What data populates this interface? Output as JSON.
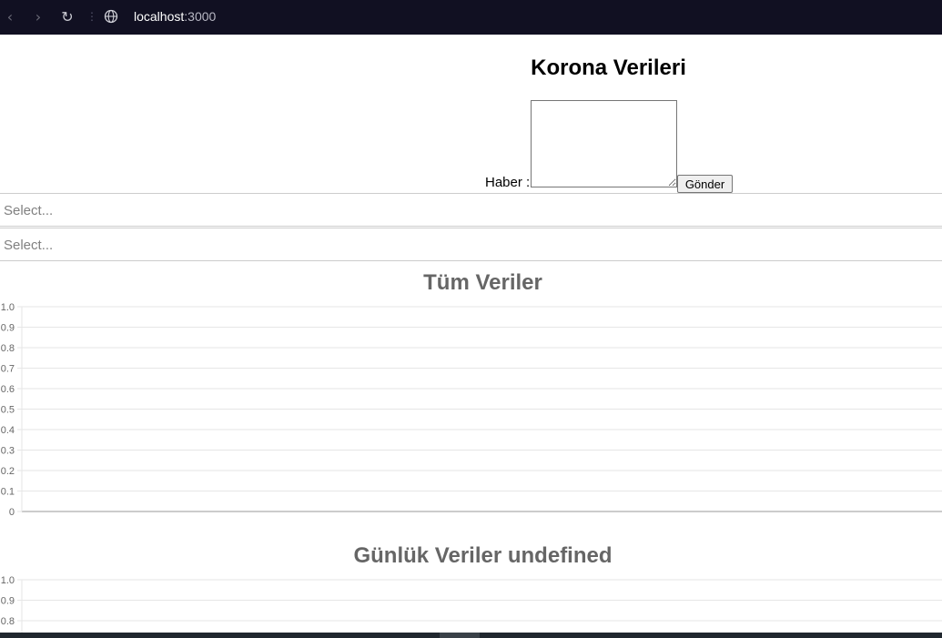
{
  "browser": {
    "url_host": "localhost",
    "url_port": ":3000",
    "icons": [
      "back-icon",
      "forward-icon",
      "reload-icon",
      "site-info-icon"
    ]
  },
  "page": {
    "title": "Korona Verileri",
    "form": {
      "haber_label": "Haber :",
      "textarea_value": "",
      "send_label": "Gönder"
    },
    "selects": [
      {
        "placeholder": "Select..."
      },
      {
        "placeholder": "Select..."
      }
    ]
  },
  "chart_data": [
    {
      "type": "line",
      "title": "Tüm Veriler",
      "series": [],
      "y_ticks": [
        "0",
        "0.1",
        "0.2",
        "0.3",
        "0.4",
        "0.5",
        "0.6",
        "0.7",
        "0.8",
        "0.9",
        "1.0"
      ],
      "ylim": [
        0,
        1.0
      ],
      "grid": true
    },
    {
      "type": "line",
      "title": "Günlük Veriler  undefined",
      "series": [],
      "y_ticks": [
        "0.8",
        "0.9",
        "1.0"
      ],
      "ylim": [
        0,
        1.0
      ],
      "grid": true
    }
  ]
}
